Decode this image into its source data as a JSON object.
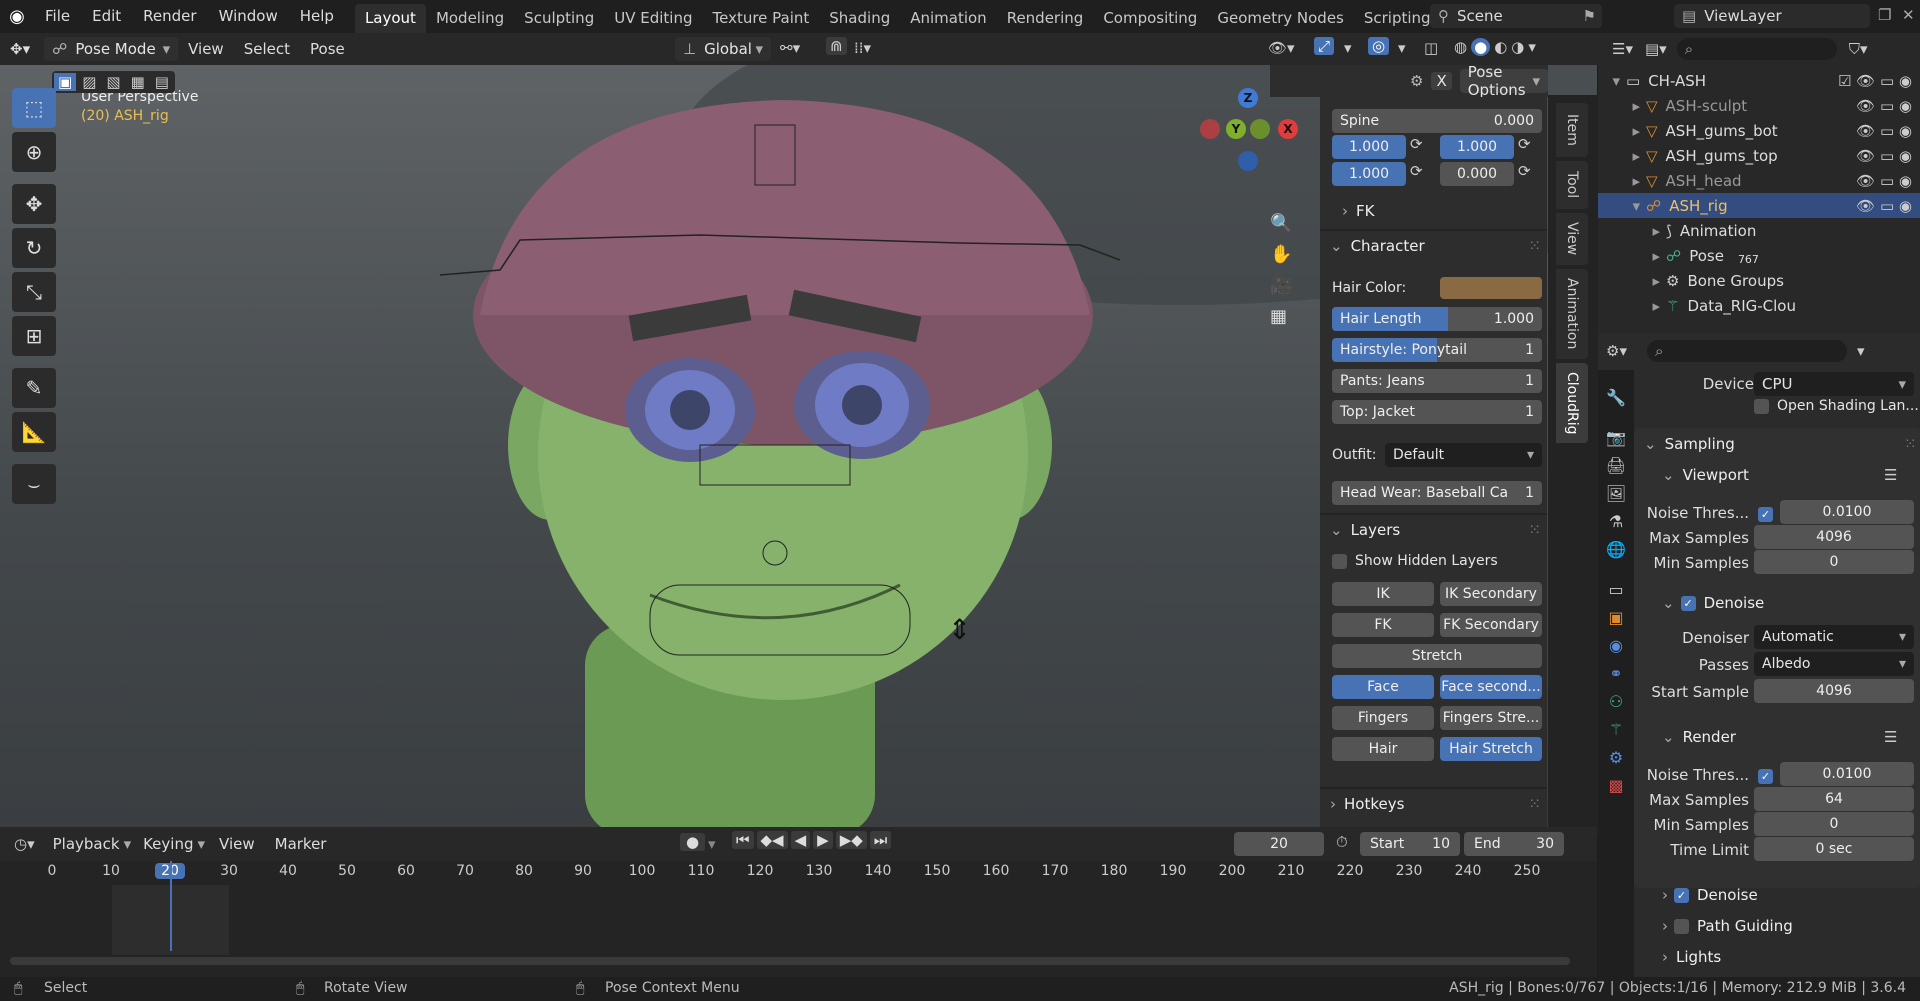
{
  "topbar": {
    "menus": [
      "File",
      "Edit",
      "Render",
      "Window",
      "Help"
    ],
    "workspaces": [
      "Layout",
      "Modeling",
      "Sculpting",
      "UV Editing",
      "Texture Paint",
      "Shading",
      "Animation",
      "Rendering",
      "Compositing",
      "Geometry Nodes",
      "Scripting"
    ],
    "add": "+",
    "scene": "Scene",
    "viewlayer": "ViewLayer"
  },
  "header": {
    "mode": "Pose Mode",
    "view": "View",
    "select": "Select",
    "pose": "Pose",
    "transform": "Global",
    "pose_options": "Pose Options",
    "x_label": "X"
  },
  "viewport": {
    "perspective": "User Perspective",
    "object_info": "(20) ASH_rig",
    "axis_x": "X",
    "axis_y": "Y",
    "axis_z": "Z"
  },
  "npanel": {
    "spine_label": "Spine",
    "spine_value": "0.000",
    "v1": "1.000",
    "v2": "1.000",
    "v3": "1.000",
    "v4": "0.000",
    "fk": "FK",
    "character": "Character",
    "hair_color": "Hair Color:",
    "hair_color_value": "#8a6a42",
    "hair_length": "Hair Length",
    "hair_length_value": "1.000",
    "hair_length_fraction": 0.55,
    "hairstyle": "Hairstyle: Ponytail",
    "hairstyle_value": "1",
    "pants": "Pants: Jeans",
    "pants_value": "1",
    "top": "Top: Jacket",
    "top_value": "1",
    "outfit_label": "Outfit:",
    "outfit_value": "Default",
    "headwear": "Head Wear: Baseball Ca",
    "headwear_value": "1",
    "layers": "Layers",
    "show_hidden": "Show Hidden Layers",
    "layer_buttons": [
      [
        "IK",
        "IK Secondary"
      ],
      [
        "FK",
        "FK Secondary"
      ],
      [
        "Stretch"
      ],
      [
        "Face",
        "Face second..."
      ],
      [
        "Fingers",
        "Fingers Stre..."
      ],
      [
        "Hair",
        "Hair Stretch"
      ]
    ],
    "hotkeys": "Hotkeys"
  },
  "vtabs": [
    "Item",
    "Tool",
    "View",
    "Animation",
    "CloudRig"
  ],
  "outliner": {
    "rows": [
      {
        "name": "CH-ASH",
        "indent": 0
      },
      {
        "name": "ASH-sculpt",
        "indent": 1
      },
      {
        "name": "ASH_gums_bot",
        "indent": 1
      },
      {
        "name": "ASH_gums_top",
        "indent": 1
      },
      {
        "name": "ASH_head",
        "indent": 1
      },
      {
        "name": "ASH_rig",
        "indent": 1
      },
      {
        "name": "Animation",
        "indent": 2
      },
      {
        "name": "Pose",
        "indent": 2,
        "badge": "767"
      },
      {
        "name": "Bone Groups",
        "indent": 2
      },
      {
        "name": "Data_RIG-Clou",
        "indent": 2
      }
    ]
  },
  "properties": {
    "device_label": "Device",
    "device_value": "CPU",
    "open_shading": "Open Shading Lan...",
    "sampling": "Sampling",
    "viewport": "Viewport",
    "noise_thresh": "Noise Thres...",
    "vp_noise": "0.0100",
    "max_samples": "Max Samples",
    "vp_max": "4096",
    "min_samples": "Min Samples",
    "vp_min": "0",
    "denoise": "Denoise",
    "denoiser_label": "Denoiser",
    "denoiser_value": "Automatic",
    "passes_label": "Passes",
    "passes_value": "Albedo",
    "start_sample": "Start Sample",
    "start_sample_value": "4096",
    "render": "Render",
    "r_noise": "0.0100",
    "r_max": "64",
    "r_min": "0",
    "time_limit": "Time Limit",
    "time_limit_value": "0 sec",
    "denoise2": "Denoise",
    "path_guiding": "Path Guiding",
    "lights": "Lights"
  },
  "timeline": {
    "playback": "Playback",
    "keying": "Keying",
    "view": "View",
    "marker": "Marker",
    "current_frame": "20",
    "start_label": "Start",
    "start": "10",
    "end_label": "End",
    "end": "30",
    "ticks": [
      "0",
      "10",
      "20",
      "30",
      "40",
      "50",
      "60",
      "70",
      "80",
      "90",
      "100",
      "110",
      "120",
      "130",
      "140",
      "150",
      "160",
      "170",
      "180",
      "190",
      "200",
      "210",
      "220",
      "230",
      "240",
      "250"
    ]
  },
  "status": {
    "select": "Select",
    "rotate": "Rotate View",
    "context": "Pose Context Menu",
    "info": "ASH_rig | Bones:0/767 | Objects:1/16 | Memory: 212.9 MiB | 3.6.4"
  }
}
